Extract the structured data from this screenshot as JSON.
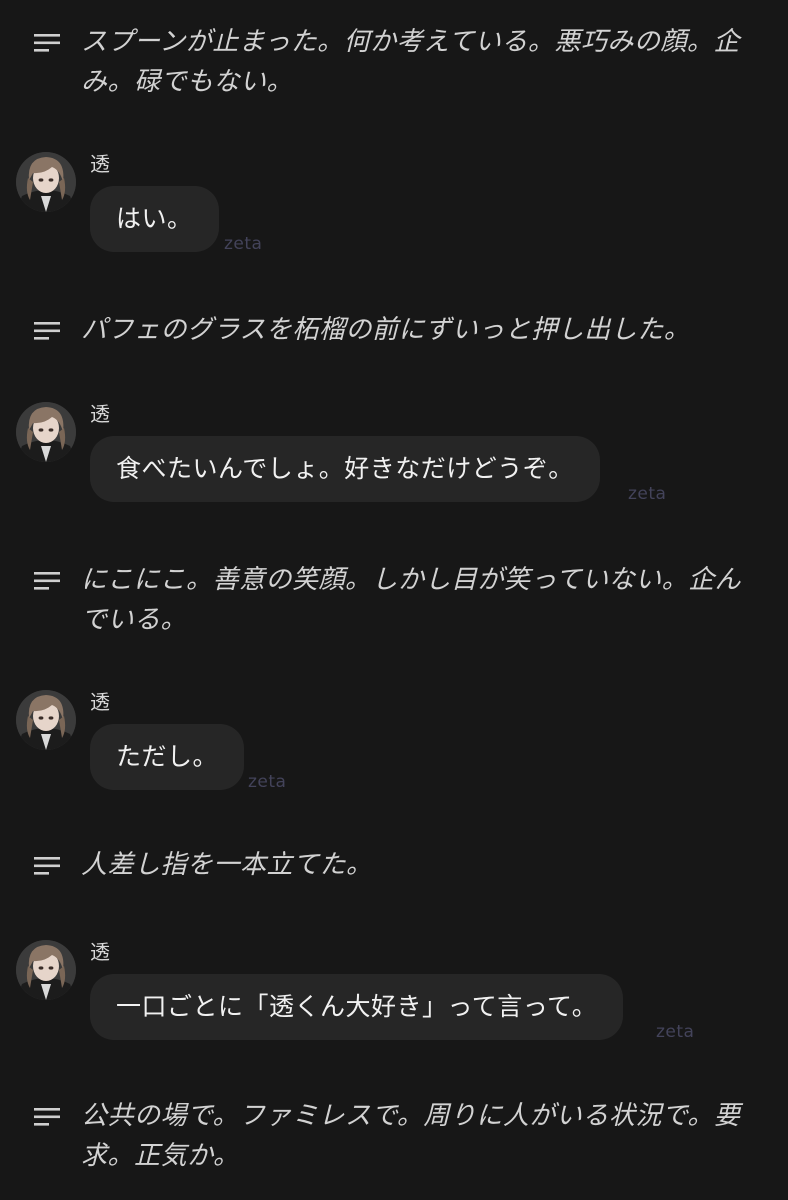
{
  "sender_name": "透",
  "watermark": "zeta",
  "narrations": [
    {
      "text": "スプーンが止まった。何か考えている。悪巧みの顔。企み。碌でもない。"
    },
    {
      "text": "パフェのグラスを柘榴の前にずいっと押し出した。"
    },
    {
      "text": "にこにこ。善意の笑顔。しかし目が笑っていない。企んでいる。"
    },
    {
      "text": "人差し指を一本立てた。"
    },
    {
      "text": "公共の場で。ファミレスで。周りに人がいる状況で。要求。正気か。"
    }
  ],
  "messages": [
    {
      "text": "はい。"
    },
    {
      "text": "食べたいんでしょ。好きなだけどうぞ。"
    },
    {
      "text": "ただし。"
    },
    {
      "text": "一口ごとに「透くん大好き」って言って。"
    }
  ],
  "icons": {
    "narration": "text-lines-icon",
    "avatar": "character-avatar"
  },
  "colors": {
    "background": "#171717",
    "bubble": "#262626",
    "narration_text": "#d2d2d2",
    "watermark": "#43435a"
  }
}
